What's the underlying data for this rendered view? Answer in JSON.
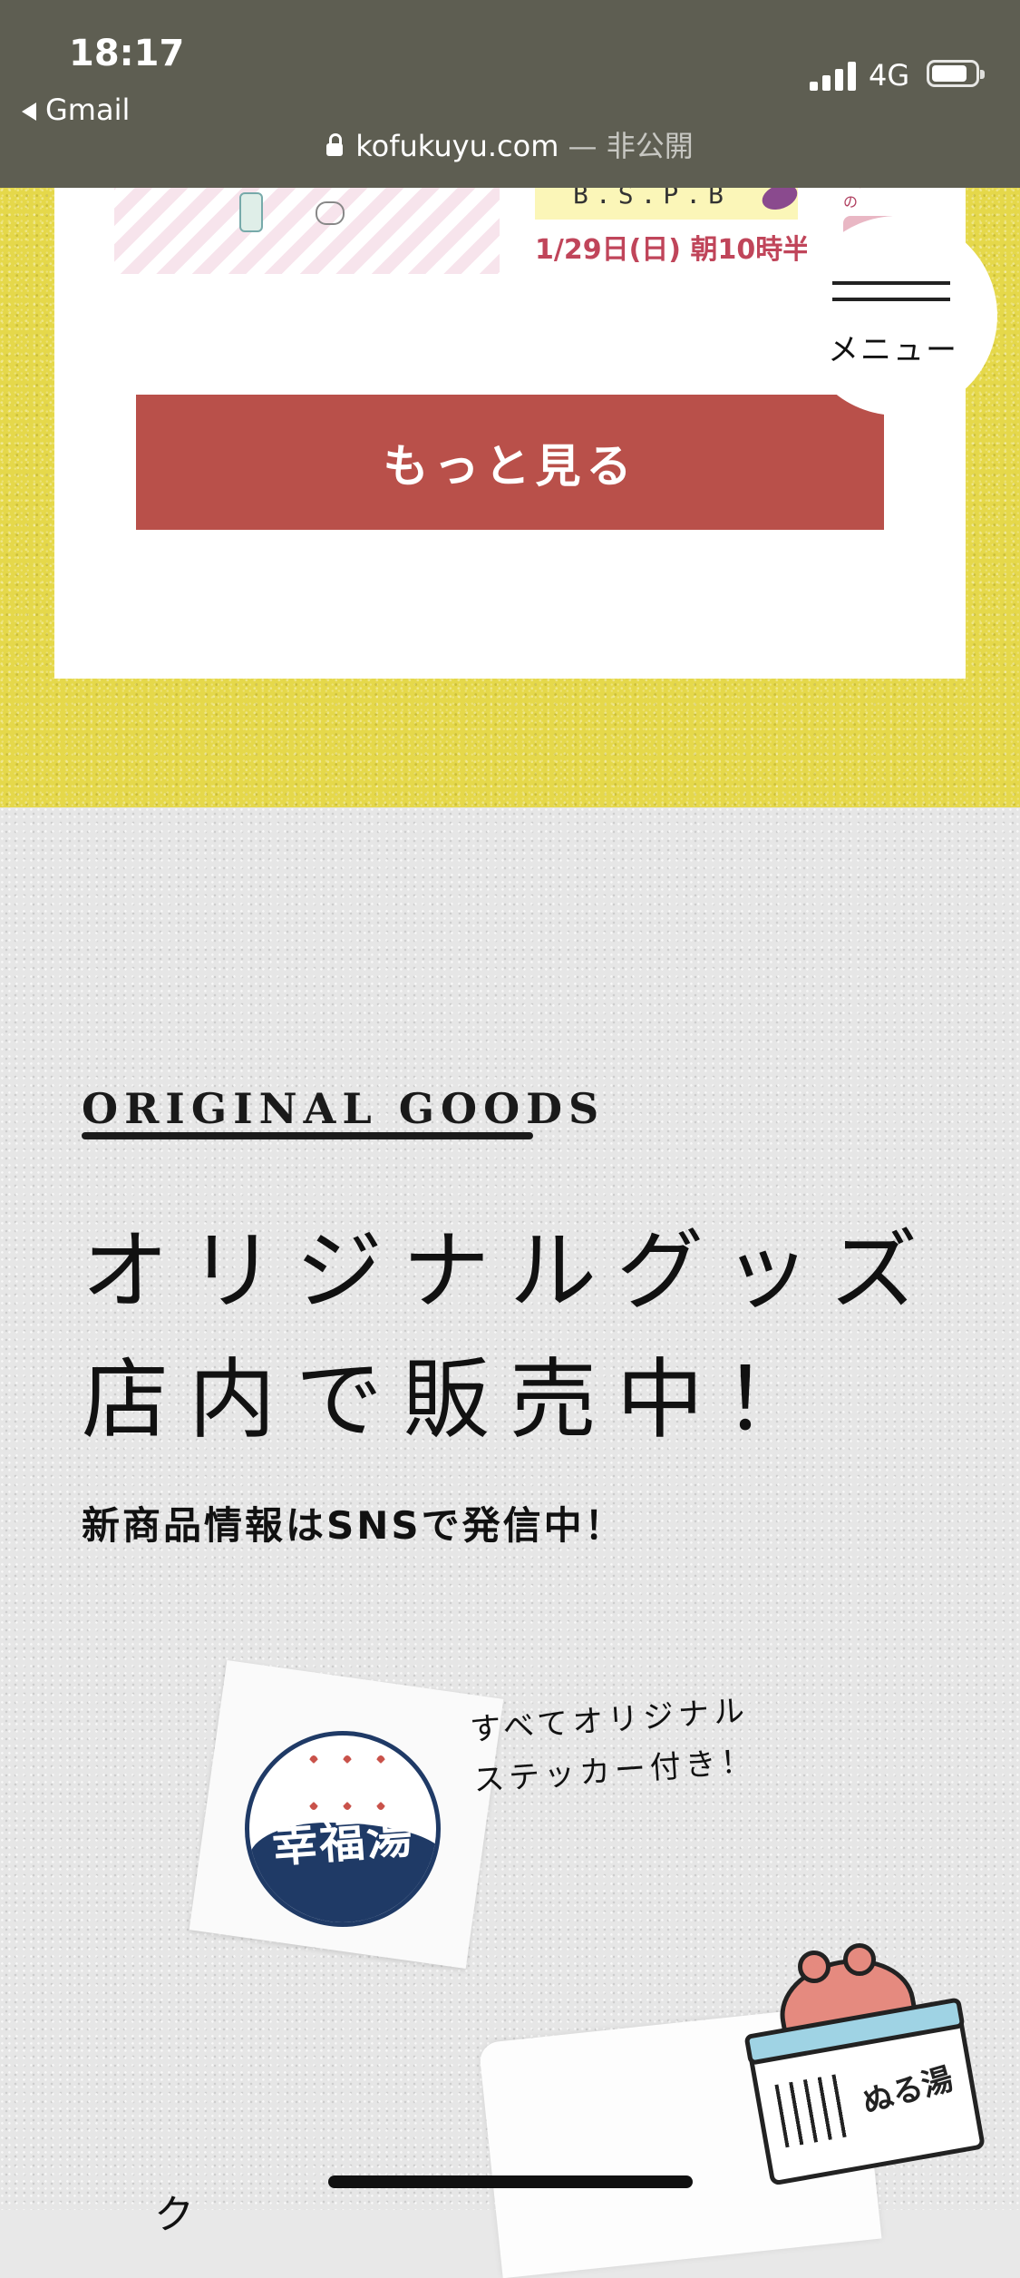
{
  "status_bar": {
    "time": "18:17",
    "back_label": "Gmail",
    "network": "4G"
  },
  "url_bar": {
    "domain": "kofukuyu.com",
    "privacy": "— 非公開"
  },
  "card": {
    "left_image": "",
    "right_banner_text": "B.S.P.B",
    "right_date_text": "1/29日(日) 朝10時半",
    "far_text": "※ずマスクの"
  },
  "more_button_label": "もっと見る",
  "menu": {
    "label": "メニュー"
  },
  "goods": {
    "section_label": "ORIGINAL GOODS",
    "headline_line1": "オリジナルグッズ",
    "headline_line2": "店内で販売中！",
    "subline": "新商品情報はSNSで発信中！",
    "sticker_note_line1": "すべてオリジナル",
    "sticker_note_line2": "ステッカー付き！",
    "logo_text": "幸福湯",
    "mascot_tub_text": "ぬる湯",
    "bottom_peek_text": "ク"
  },
  "colors": {
    "yellow_bg": "#e5d84a",
    "button_red": "#b9504a",
    "logo_navy": "#1f3a66",
    "steam_red": "#c9524a"
  }
}
